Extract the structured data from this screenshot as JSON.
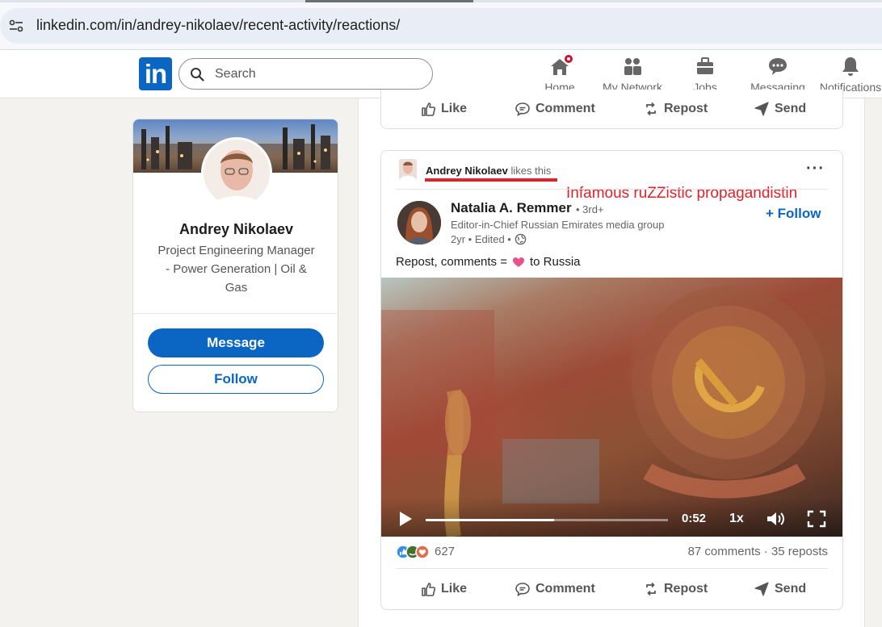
{
  "browser": {
    "url": "linkedin.com/in/andrey-nikolaev/recent-activity/reactions/"
  },
  "nav": {
    "logo": "in",
    "search_placeholder": "Search",
    "items": [
      {
        "label": "Home",
        "icon": "home-icon"
      },
      {
        "label": "My Network",
        "icon": "network-icon"
      },
      {
        "label": "Jobs",
        "icon": "briefcase-icon"
      },
      {
        "label": "Messaging",
        "icon": "chat-icon"
      },
      {
        "label": "Notifications",
        "icon": "bell-icon"
      }
    ]
  },
  "profile": {
    "name": "Andrey Nikolaev",
    "headline": "Project Engineering Manager - Power Generation | Oil & Gas",
    "message_label": "Message",
    "follow_label": "Follow"
  },
  "actions": {
    "like": "Like",
    "comment": "Comment",
    "repost": "Repost",
    "send": "Send"
  },
  "post": {
    "reactor_name": "Andrey Nikolaev",
    "reactor_suffix": "likes this",
    "annotation": "Infamous ruZZistic propagandistin",
    "author": {
      "name": "Natalia A. Remmer",
      "degree": "• 3rd+",
      "headline": "Editor-in-Chief Russian Emirates media group",
      "time": "2yr • Edited •"
    },
    "follow_label": "+ Follow",
    "text_before": "Repost, comments =",
    "text_after": "to Russia",
    "video": {
      "time_remaining": "0:52",
      "speed": "1x",
      "progress_fraction": 0.53
    },
    "reaction_count": "627",
    "social_counts": "87 comments · 35 reposts"
  },
  "colors": {
    "brand": "#0a66c2",
    "annotation_red": "#e4212a",
    "notification_badge": "#cb112d"
  }
}
